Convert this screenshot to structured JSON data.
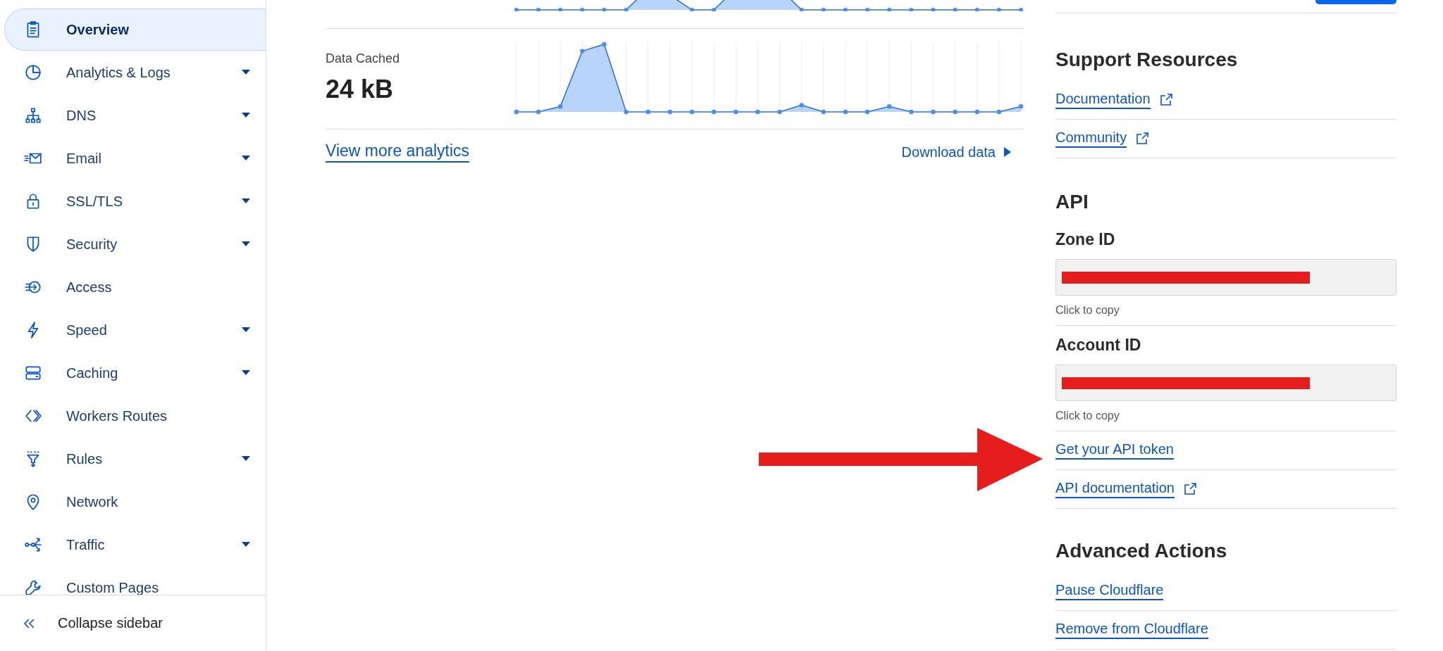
{
  "sidebar": {
    "items": [
      {
        "label": "Overview",
        "selected": true,
        "expandable": false
      },
      {
        "label": "Analytics & Logs",
        "selected": false,
        "expandable": true
      },
      {
        "label": "DNS",
        "selected": false,
        "expandable": true
      },
      {
        "label": "Email",
        "selected": false,
        "expandable": true
      },
      {
        "label": "SSL/TLS",
        "selected": false,
        "expandable": true
      },
      {
        "label": "Security",
        "selected": false,
        "expandable": true
      },
      {
        "label": "Access",
        "selected": false,
        "expandable": false
      },
      {
        "label": "Speed",
        "selected": false,
        "expandable": true
      },
      {
        "label": "Caching",
        "selected": false,
        "expandable": true
      },
      {
        "label": "Workers Routes",
        "selected": false,
        "expandable": false
      },
      {
        "label": "Rules",
        "selected": false,
        "expandable": true
      },
      {
        "label": "Network",
        "selected": false,
        "expandable": false
      },
      {
        "label": "Traffic",
        "selected": false,
        "expandable": true
      },
      {
        "label": "Custom Pages",
        "selected": false,
        "expandable": false
      }
    ],
    "collapse": "Collapse sidebar"
  },
  "analytics": {
    "metric": {
      "label": "Data Cached",
      "value": "24 kB"
    },
    "more_link": "View more analytics",
    "download": "Download data"
  },
  "support": {
    "title": "Support Resources",
    "links": [
      "Documentation",
      "Community"
    ]
  },
  "api": {
    "title": "API",
    "fields": [
      {
        "label": "Zone ID",
        "hint": "Click to copy"
      },
      {
        "label": "Account ID",
        "hint": "Click to copy"
      }
    ],
    "links": [
      {
        "label": "Get your API token",
        "external": false
      },
      {
        "label": "API documentation",
        "external": true
      }
    ]
  },
  "advanced": {
    "title": "Advanced Actions",
    "links": [
      "Pause Cloudflare",
      "Remove from Cloudflare"
    ]
  }
}
